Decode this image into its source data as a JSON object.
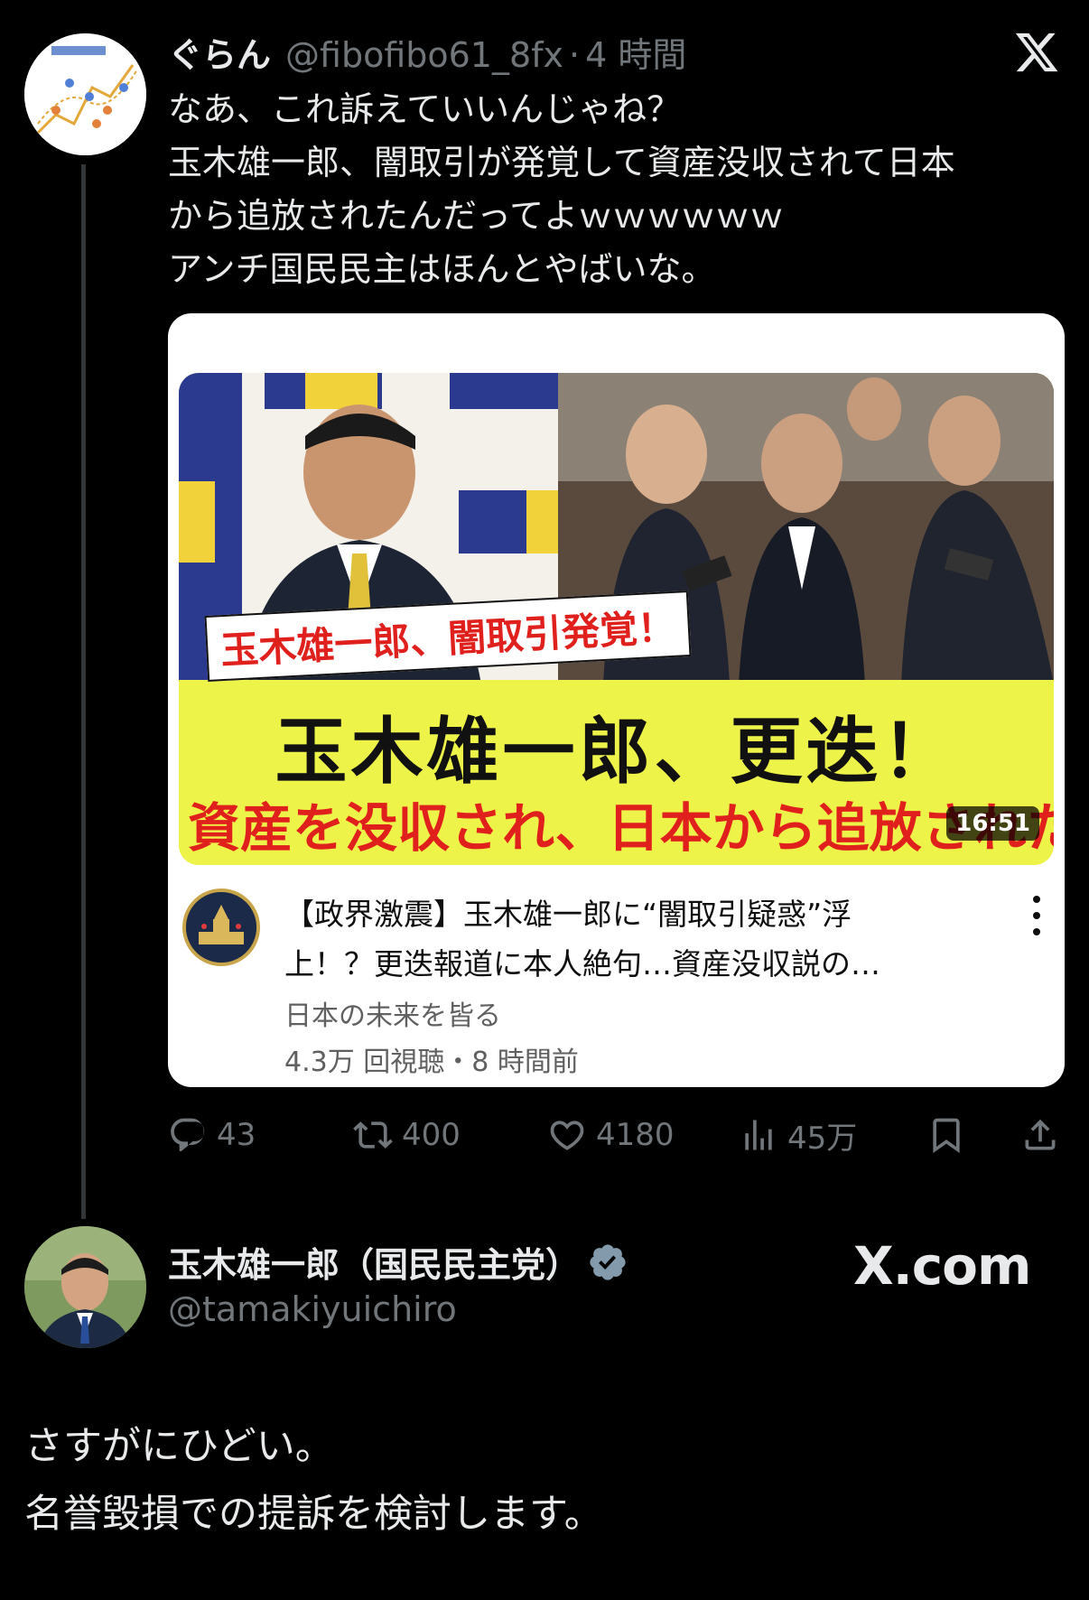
{
  "tweet1": {
    "avatar_name": "chart-avatar",
    "name": "ぐらん",
    "handle": "@fibofibo61_8fx",
    "separator": "·",
    "time": "4 時間",
    "lines": [
      "なあ、これ訴えていいんじゃね？",
      "玉木雄一郎、闇取引が発覚して資産没収されて日本",
      "から追放されたんだってよｗｗｗｗｗｗ",
      "アンチ国民民主はほんとやばいな。"
    ]
  },
  "video_card": {
    "thumbnail": {
      "caption_red": "玉木雄一郎、闇取引発覚！",
      "main": "玉木雄一郎、更迭！",
      "sub": "資産を没収され、日本から追放された！",
      "duration": "16:51"
    },
    "title_lines": [
      "【政界激震】玉木雄一郎に“闇取引疑惑”浮",
      "上！？更迭報道に本人絶句…資産没収説の…"
    ],
    "channel": "日本の未来を皆る",
    "meta": "4.3万 回視聴・8 時間前"
  },
  "actions": {
    "reply": "43",
    "retweet": "400",
    "like": "4180",
    "views": "45万"
  },
  "tweet2": {
    "name": "玉木雄一郎（国民民主党）",
    "handle": "@tamakiyuichiro",
    "watermark": "X.com",
    "lines": [
      "さすがにひどい。",
      "名誉毀損での提訴を検討します。"
    ]
  },
  "colors": {
    "background": "#000000",
    "text": "#e7e9ea",
    "secondary": "#71767b",
    "verified": "#829aab",
    "thumb_yellow": "#eef34a",
    "thumb_red": "#e0201d"
  }
}
